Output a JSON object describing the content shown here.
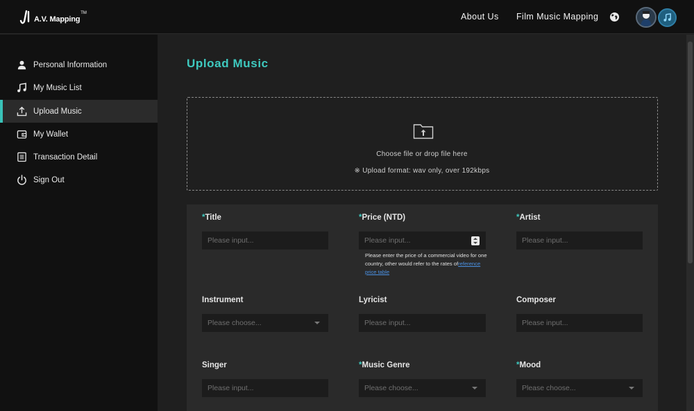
{
  "header": {
    "logo_text": "A.V. Mapping",
    "logo_tm": "TM",
    "nav": [
      {
        "label": "About Us"
      },
      {
        "label": "Film Music Mapping"
      }
    ]
  },
  "sidebar": {
    "items": [
      {
        "label": "Personal Information",
        "icon": "user-icon"
      },
      {
        "label": "My Music List",
        "icon": "music-note-icon"
      },
      {
        "label": "Upload Music",
        "icon": "upload-icon",
        "active": true
      },
      {
        "label": "My Wallet",
        "icon": "wallet-icon"
      },
      {
        "label": "Transaction Detail",
        "icon": "document-icon"
      },
      {
        "label": "Sign Out",
        "icon": "power-icon"
      }
    ]
  },
  "main": {
    "title": "Upload Music",
    "dropzone": {
      "text": "Choose file or drop file here",
      "format_note": "※ Upload format: wav only, over 192kbps"
    },
    "form": {
      "title": {
        "label": "Title",
        "required": "*",
        "placeholder": "Please input..."
      },
      "price": {
        "label": "Price (NTD)",
        "required": "*",
        "placeholder": "Please input...",
        "hint": "Please enter the price of a commercial video for one country, other would refer to the rates of",
        "hint_link": "reference price table"
      },
      "artist": {
        "label": "Artist",
        "required": "*",
        "placeholder": "Please input..."
      },
      "instrument": {
        "label": "Instrument",
        "placeholder": "Please choose..."
      },
      "lyricist": {
        "label": "Lyricist",
        "placeholder": "Please input..."
      },
      "composer": {
        "label": "Composer",
        "placeholder": "Please input..."
      },
      "singer": {
        "label": "Singer",
        "placeholder": "Please input..."
      },
      "music_genre": {
        "label": "Music Genre",
        "required": "*",
        "placeholder": "Please choose..."
      },
      "mood": {
        "label": "Mood",
        "required": "*",
        "placeholder": "Please choose..."
      }
    }
  },
  "colors": {
    "accent": "#3ec9bf",
    "link": "#4a90e2",
    "background": "#1f1f1f",
    "panel": "#2a2a2a",
    "header": "#111111"
  }
}
